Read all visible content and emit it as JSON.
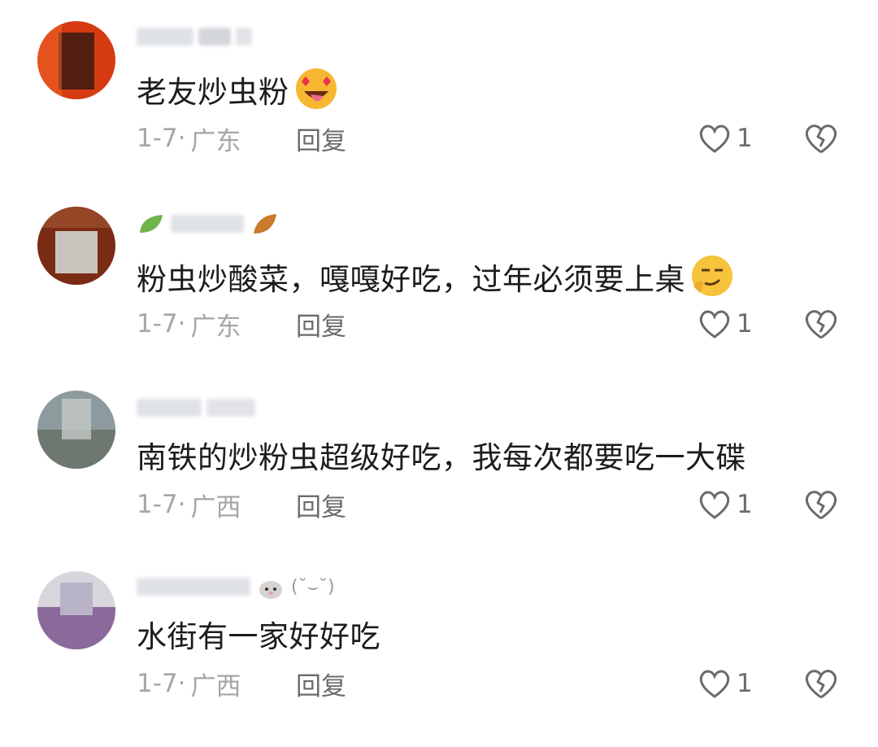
{
  "comments": [
    {
      "text": "老友炒虫粉",
      "emoji": "heart-eyes-tongue-emoji",
      "date": "1-7",
      "location": "广东",
      "reply_label": "回复",
      "likes": "1",
      "avatar_colors": [
        "#d63a10",
        "#f26b2a",
        "#3a1a10"
      ]
    },
    {
      "text": "粉虫炒酸菜，嘎嘎好吃，过年必须要上桌",
      "emoji": "smug-thinking-emoji",
      "date": "1-7",
      "location": "广东",
      "reply_label": "回复",
      "likes": "1",
      "avatar_colors": [
        "#7a2b14",
        "#c9c4bd",
        "#a0522d"
      ]
    },
    {
      "text": "南铁的炒粉虫超级好吃，我每次都要吃一大碟",
      "emoji": "",
      "date": "1-7",
      "location": "广西",
      "reply_label": "回复",
      "likes": "1",
      "avatar_colors": [
        "#8d9a9e",
        "#c4c9c6",
        "#6e7870"
      ]
    },
    {
      "text": "水街有一家好好吃",
      "emoji": "",
      "date": "1-7",
      "location": "广西",
      "reply_label": "回复",
      "likes": "1",
      "avatar_colors": [
        "#b9b3c8",
        "#8a6a9a",
        "#d8d6dc"
      ]
    }
  ],
  "colors": {
    "meta": "#a6a6a6",
    "action": "#6b6b6b",
    "text": "#1c1c1c"
  }
}
